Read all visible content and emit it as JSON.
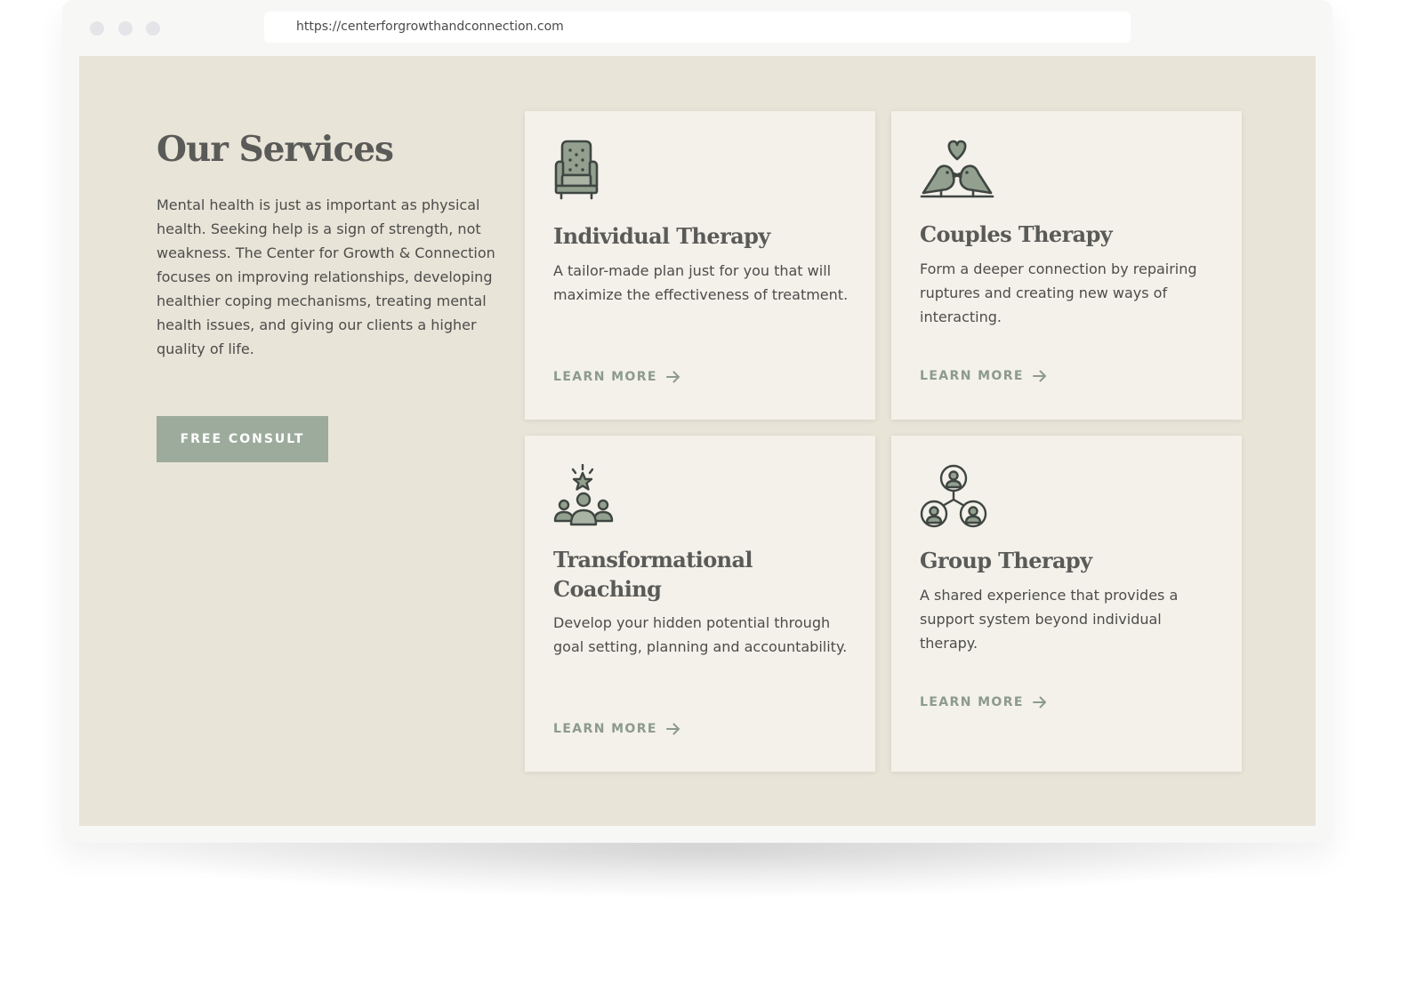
{
  "browser": {
    "url": "https://centerforgrowthandconnection.com"
  },
  "intro": {
    "title": "Our Services",
    "body": "Mental health is just as important as physical health. Seeking help is a sign of strength, not weakness. The Center for Growth & Connection focuses on improving relationships, developing healthier coping mechanisms, treating mental health issues, and giving our clients a higher quality of life.",
    "cta_label": "FREE CONSULT"
  },
  "services": [
    {
      "icon": "armchair-icon",
      "title": "Individual Therapy",
      "description": "A tailor-made plan just for you that will maximize the effectiveness of treatment.",
      "link_label": "LEARN MORE"
    },
    {
      "icon": "lovebirds-icon",
      "title": "Couples Therapy",
      "description": "Form a deeper connection by repairing ruptures and creating new ways of interacting.",
      "link_label": "LEARN MORE"
    },
    {
      "icon": "team-star-icon",
      "title": "Transformational Coaching",
      "description": "Develop your hidden potential through goal setting, planning and accountability.",
      "link_label": "LEARN MORE"
    },
    {
      "icon": "group-network-icon",
      "title": "Group Therapy",
      "description": "A shared experience that provides a support system beyond individual therapy.",
      "link_label": "LEARN MORE"
    }
  ],
  "colors": {
    "page_background": "#e8e4d8",
    "card_background": "#f4f1ea",
    "sage_accent": "#9dab9c",
    "heading_text": "#5a5b58",
    "body_text": "#4c4c4a",
    "link_text": "#8c9a8c",
    "icon_stroke": "#3f4642"
  }
}
